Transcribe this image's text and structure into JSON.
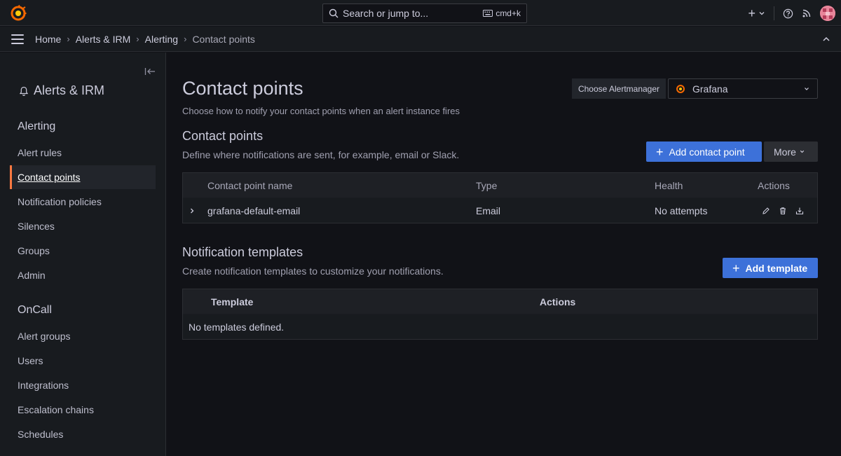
{
  "topbar": {
    "search_placeholder": "Search or jump to...",
    "search_shortcut": "cmd+k",
    "add_label": "+"
  },
  "breadcrumbs": [
    "Home",
    "Alerts & IRM",
    "Alerting",
    "Contact points"
  ],
  "sidebar": {
    "section_title": "Alerts & IRM",
    "groups": [
      {
        "title": "Alerting",
        "items": [
          "Alert rules",
          "Contact points",
          "Notification policies",
          "Silences",
          "Groups",
          "Admin"
        ]
      },
      {
        "title": "OnCall",
        "items": [
          "Alert groups",
          "Users",
          "Integrations",
          "Escalation chains",
          "Schedules"
        ]
      }
    ],
    "active_item": "Contact points"
  },
  "page": {
    "title": "Contact points",
    "subtitle": "Choose how to notify your contact points when an alert instance fires",
    "alertmanager_label": "Choose Alertmanager",
    "alertmanager_value": "Grafana"
  },
  "contact_points": {
    "heading": "Contact points",
    "description": "Define where notifications are sent, for example, email or Slack.",
    "add_button": "Add contact point",
    "more_button": "More",
    "columns": [
      "Contact point name",
      "Type",
      "Health",
      "Actions"
    ],
    "rows": [
      {
        "name": "grafana-default-email",
        "type": "Email",
        "health": "No attempts"
      }
    ]
  },
  "templates": {
    "heading": "Notification templates",
    "description": "Create notification templates to customize your notifications.",
    "add_button": "Add template",
    "columns": [
      "Template",
      "Actions"
    ],
    "empty_text": "No templates defined."
  },
  "colors": {
    "accent": "#ff7941",
    "primary_button": "#3d71d9",
    "background": "#111217",
    "panel": "#181b1f"
  }
}
